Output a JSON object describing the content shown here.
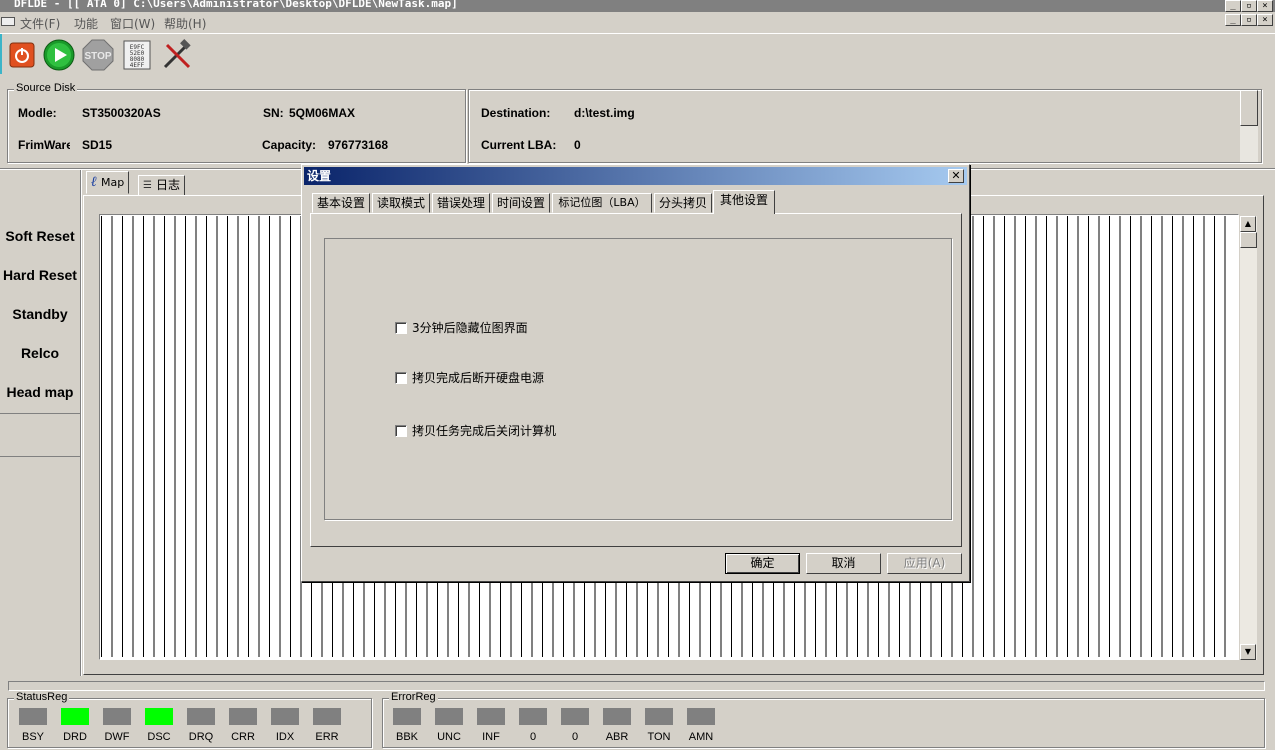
{
  "window": {
    "title": "DFLDE - [[ ATA 0]  C:\\Users\\Administrator\\Desktop\\DFLDE\\NewTask.map]"
  },
  "menu": [
    "文件(F)",
    "功能",
    "窗口(W)",
    "帮助(H)"
  ],
  "toolbar": {
    "power_icon": "power-icon",
    "play_icon": "play-icon",
    "stop_label": "STOP",
    "hex_icon": "hex-editor-icon",
    "tools_icon": "tools-icon",
    "hex_text": "E9FC\n52E0\n8080\n4EFF"
  },
  "source_disk": {
    "title": "Source Disk",
    "model_label": "Modle:",
    "model": "ST3500320AS",
    "sn_label": "SN:",
    "sn": "5QM06MAX",
    "firmware_label": "FrimWare",
    "firmware": "SD15",
    "capacity_label": "Capacity:",
    "capacity": "976773168"
  },
  "destination": {
    "dest_label": "Destination:",
    "dest": "d:\\test.img",
    "lba_label": "Current LBA:",
    "lba": "0"
  },
  "side_buttons": [
    "Soft Reset",
    "Hard Reset",
    "Standby",
    "Relco",
    "Head map"
  ],
  "map_tabs": [
    "Map",
    "日志"
  ],
  "dialog": {
    "title": "设置",
    "close": "✕",
    "tabs": [
      "基本设置",
      "读取模式",
      "错误处理",
      "时间设置",
      "标记位图（LBA）",
      "分头拷贝",
      "其他设置"
    ],
    "active_tab": 6,
    "options": [
      {
        "label": "3分钟后隐藏位图界面",
        "checked": false
      },
      {
        "label": "拷贝完成后断开硬盘电源",
        "checked": false
      },
      {
        "label": "拷贝任务完成后关闭计算机",
        "checked": false
      }
    ],
    "ok": "确定",
    "cancel": "取消",
    "apply": "应用(A)"
  },
  "status_reg": {
    "title": "StatusReg",
    "items": [
      {
        "label": "BSY",
        "on": false
      },
      {
        "label": "DRD",
        "on": true
      },
      {
        "label": "DWF",
        "on": false
      },
      {
        "label": "DSC",
        "on": true
      },
      {
        "label": "DRQ",
        "on": false
      },
      {
        "label": "CRR",
        "on": false
      },
      {
        "label": "IDX",
        "on": false
      },
      {
        "label": "ERR",
        "on": false
      }
    ]
  },
  "error_reg": {
    "title": "ErrorReg",
    "items": [
      {
        "label": "BBK",
        "on": false
      },
      {
        "label": "UNC",
        "on": false
      },
      {
        "label": "INF",
        "on": false
      },
      {
        "label": "0",
        "on": false
      },
      {
        "label": "0",
        "on": false
      },
      {
        "label": "ABR",
        "on": false
      },
      {
        "label": "TON",
        "on": false
      },
      {
        "label": "AMN",
        "on": false
      }
    ]
  },
  "colors": {
    "light_on": "#00ff00",
    "light_off": "#808080",
    "title_gradient_start": "#0a246a",
    "title_gradient_end": "#a6caf0"
  }
}
